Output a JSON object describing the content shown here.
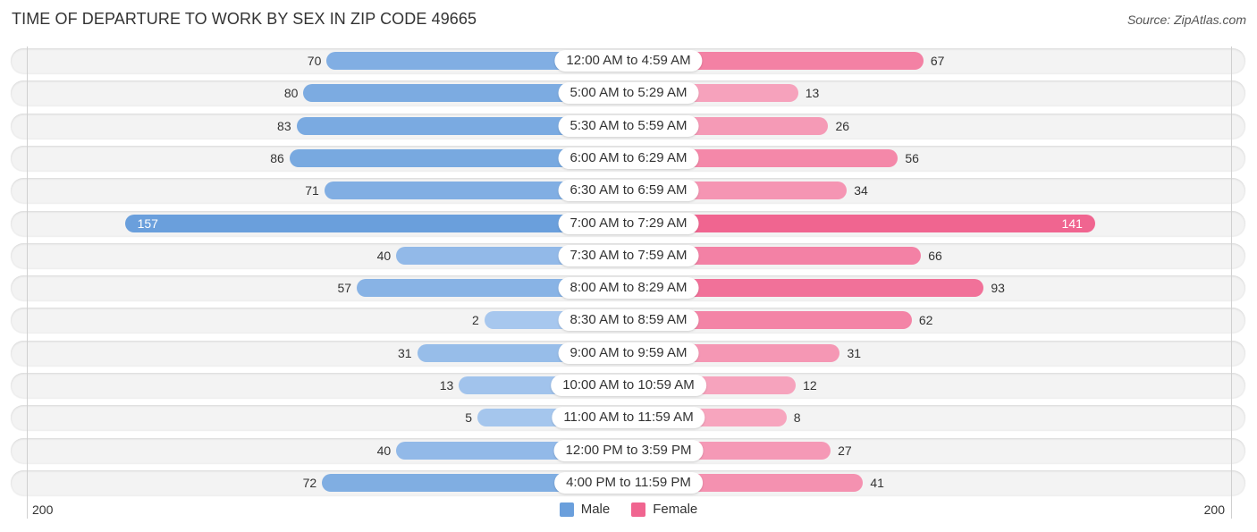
{
  "header": {
    "title": "TIME OF DEPARTURE TO WORK BY SEX IN ZIP CODE 49665",
    "source": "Source: ZipAtlas.com"
  },
  "colors": {
    "male_strong": "#6a9fdc",
    "male_light": "#a8c8ee",
    "female_strong": "#f06590",
    "female_light": "#f7aac2"
  },
  "legend": {
    "items": [
      {
        "label": "Male",
        "color": "#6a9fdc"
      },
      {
        "label": "Female",
        "color": "#f06590"
      }
    ],
    "position": "bottom-center"
  },
  "axis": {
    "left_tick": "200",
    "right_tick": "200"
  },
  "chart_data": {
    "type": "bar",
    "orientation": "horizontal-diverging",
    "title": "TIME OF DEPARTURE TO WORK BY SEX IN ZIP CODE 49665",
    "xlabel": "",
    "ylabel": "",
    "xlim": [
      0,
      200
    ],
    "grid": false,
    "legend_position": "bottom-center",
    "categories": [
      "12:00 AM to 4:59 AM",
      "5:00 AM to 5:29 AM",
      "5:30 AM to 5:59 AM",
      "6:00 AM to 6:29 AM",
      "6:30 AM to 6:59 AM",
      "7:00 AM to 7:29 AM",
      "7:30 AM to 7:59 AM",
      "8:00 AM to 8:29 AM",
      "8:30 AM to 8:59 AM",
      "9:00 AM to 9:59 AM",
      "10:00 AM to 10:59 AM",
      "11:00 AM to 11:59 AM",
      "12:00 PM to 3:59 PM",
      "4:00 PM to 11:59 PM"
    ],
    "series": [
      {
        "name": "Male",
        "side": "left",
        "values": [
          70,
          80,
          83,
          86,
          71,
          157,
          40,
          57,
          2,
          31,
          13,
          5,
          40,
          72
        ]
      },
      {
        "name": "Female",
        "side": "right",
        "values": [
          67,
          13,
          26,
          56,
          34,
          141,
          66,
          93,
          62,
          31,
          12,
          8,
          27,
          41
        ]
      }
    ],
    "tick_labels": [
      "200",
      "200"
    ]
  }
}
